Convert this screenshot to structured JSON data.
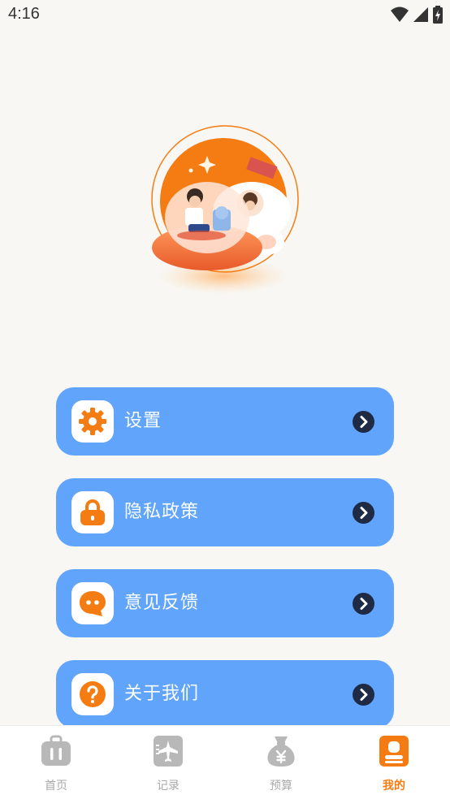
{
  "status_bar": {
    "time": "4:16"
  },
  "menu": [
    {
      "label": "设置",
      "icon": "gear-icon"
    },
    {
      "label": "隐私政策",
      "icon": "lock-icon"
    },
    {
      "label": "意见反馈",
      "icon": "chat-bubble-icon"
    },
    {
      "label": "关于我们",
      "icon": "question-icon"
    }
  ],
  "tabs": [
    {
      "label": "首页",
      "icon": "suitcase-icon",
      "active": false
    },
    {
      "label": "记录",
      "icon": "airplane-ticket-icon",
      "active": false
    },
    {
      "label": "预算",
      "icon": "money-bag-icon",
      "active": false
    },
    {
      "label": "我的",
      "icon": "profile-icon",
      "active": true
    }
  ],
  "colors": {
    "background": "#f8f7f3",
    "menu_item": "#60a4fc",
    "accent_orange": "#f57c12",
    "chevron_circle": "#1f2a44",
    "tab_inactive": "#a9a9a9"
  }
}
